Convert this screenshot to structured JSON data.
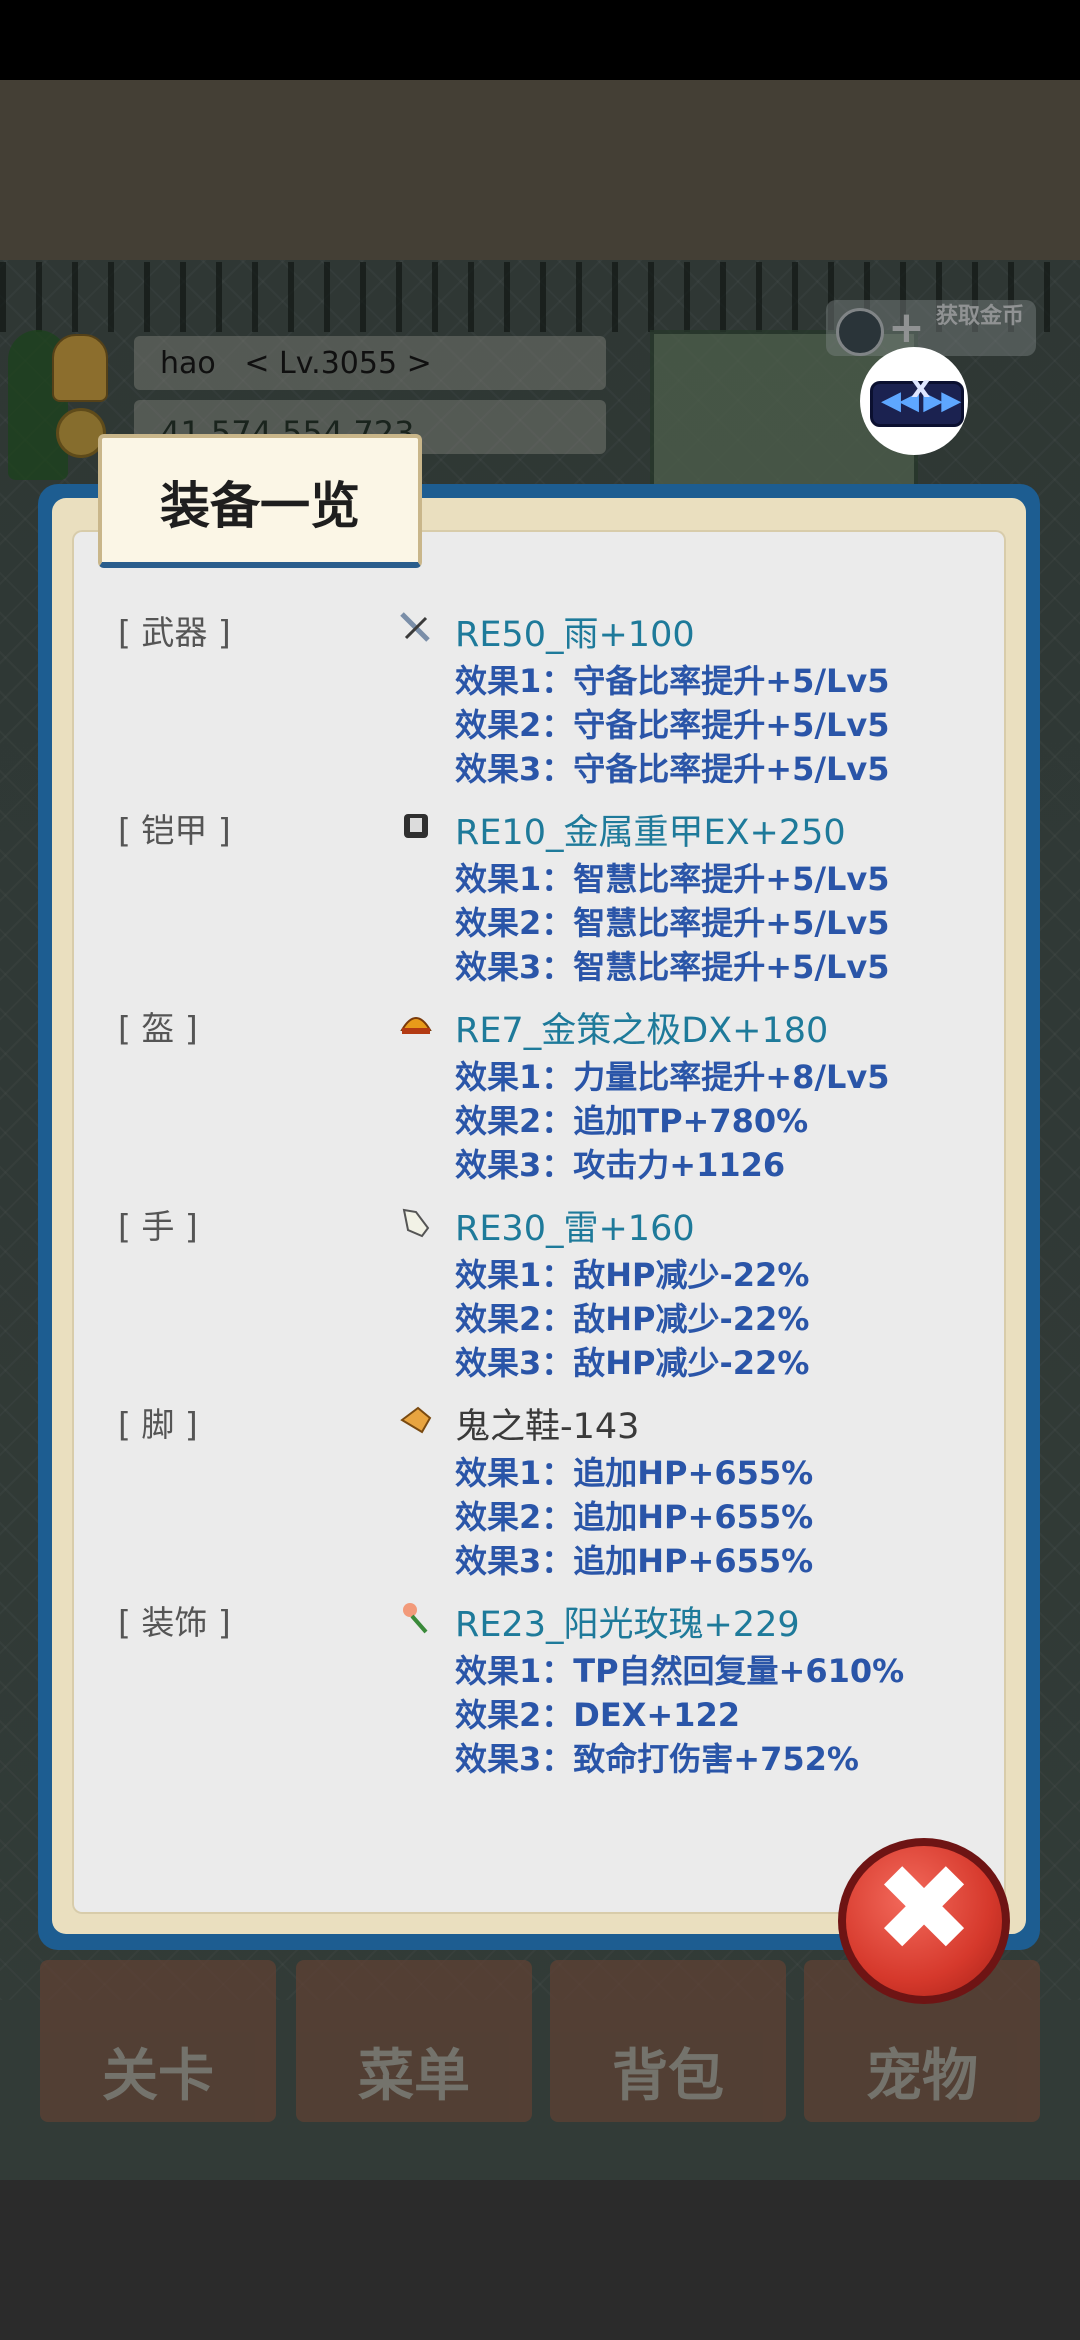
{
  "hud": {
    "player_name": "hao",
    "player_level": "< Lv.3055 >",
    "gold": "41,574,554,723",
    "obtain_button": "获取金币"
  },
  "dialog": {
    "title": "装备一览",
    "close_label": "✖"
  },
  "equipment": [
    {
      "slot": "[ 武器 ]",
      "icon": "sword-icon",
      "name": "RE50_雨+100",
      "effects": [
        "效果1：守备比率提升+5/Lv5",
        "效果2：守备比率提升+5/Lv5",
        "效果3：守备比率提升+5/Lv5"
      ]
    },
    {
      "slot": "[ 铠甲 ]",
      "icon": "armor-icon",
      "name": "RE10_金属重甲EX+250",
      "effects": [
        "效果1：智慧比率提升+5/Lv5",
        "效果2：智慧比率提升+5/Lv5",
        "效果3：智慧比率提升+5/Lv5"
      ]
    },
    {
      "slot": "[ 盔 ]",
      "icon": "helmet-icon",
      "name": "RE7_金策之极DX+180",
      "effects": [
        "效果1：力量比率提升+8/Lv5",
        "效果2：追加TP+780%",
        "效果3：攻击力+1126"
      ]
    },
    {
      "slot": "[ 手 ]",
      "icon": "glove-icon",
      "name": "RE30_雷+160",
      "effects": [
        "效果1：敌HP减少-22%",
        "效果2：敌HP减少-22%",
        "效果3：敌HP减少-22%"
      ]
    },
    {
      "slot": "[ 脚 ]",
      "icon": "boots-icon",
      "name": "鬼之鞋-143",
      "effects": [
        "效果1：追加HP+655%",
        "效果2：追加HP+655%",
        "效果3：追加HP+655%"
      ]
    },
    {
      "slot": "[ 装饰 ]",
      "icon": "rose-icon",
      "name": "RE23_阳光玫瑰+229",
      "effects": [
        "效果1：TP自然回复量+610%",
        "效果2：DEX+122",
        "效果3：致命打伤害+752%"
      ]
    }
  ],
  "bottom_nav": [
    "关卡",
    "菜单",
    "背包",
    "宠物"
  ]
}
